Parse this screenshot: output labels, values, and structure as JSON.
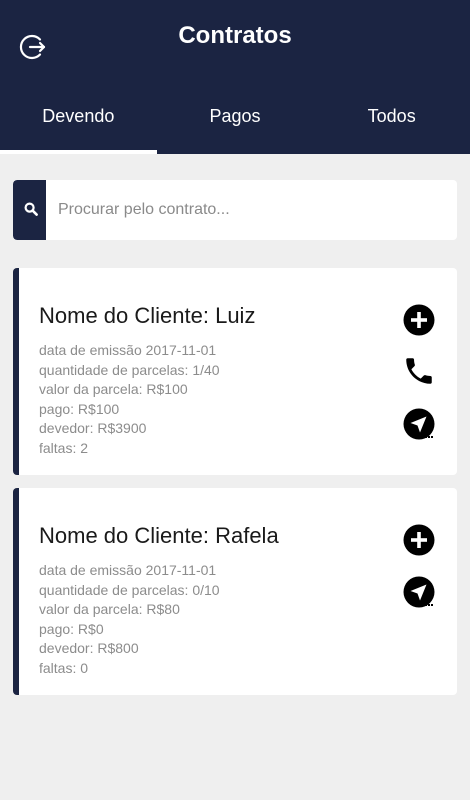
{
  "header": {
    "title": "Contratos",
    "logout_icon": "logout-icon"
  },
  "tabs": [
    {
      "label": "Devendo",
      "active": true
    },
    {
      "label": "Pagos",
      "active": false
    },
    {
      "label": "Todos",
      "active": false
    }
  ],
  "search": {
    "placeholder": "Procurar pelo contrato...",
    "value": "",
    "icon": "search-icon"
  },
  "contracts": [
    {
      "name": "Nome do Cliente: Luiz",
      "lines": [
        "data de emissão 2017-11-01",
        "quantidade de parcelas: 1/40",
        "valor da parcela: R$100",
        "pago: R$100",
        "devedor: R$3900",
        "faltas: 2"
      ],
      "actions": [
        "add-circle-icon",
        "phone-icon",
        "navigation-icon"
      ]
    },
    {
      "name": "Nome do Cliente: Rafela",
      "lines": [
        "data de emissão 2017-11-01",
        "quantidade de parcelas: 0/10",
        "valor da parcela: R$80",
        "pago: R$0",
        "devedor: R$800",
        "faltas: 0"
      ],
      "actions": [
        "add-circle-icon",
        "navigation-icon"
      ]
    }
  ],
  "colors": {
    "primary": "#1b2442",
    "background": "#efefef",
    "card": "#ffffff",
    "muted_text": "#8c8c8c"
  }
}
